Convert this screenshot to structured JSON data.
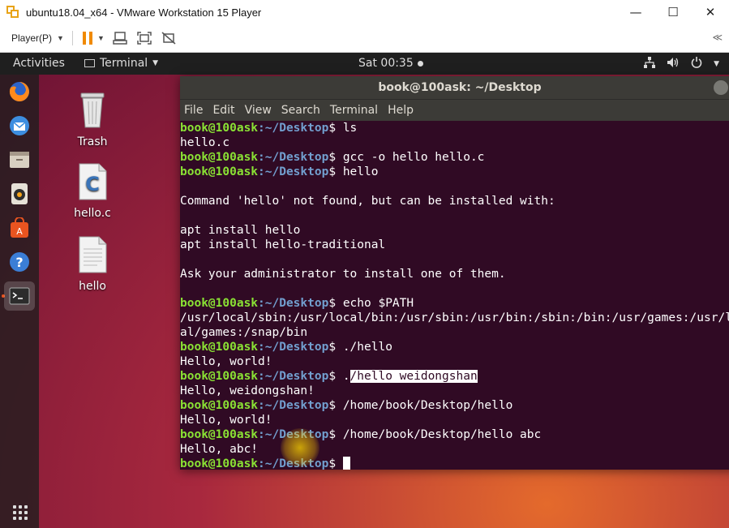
{
  "vm": {
    "title": "ubuntu18.04_x64 - VMware Workstation 15 Player",
    "controls": {
      "minimize": "—",
      "maximize": "☐",
      "close": "✕"
    },
    "player_menu": "Player(P)",
    "collapse": "≪"
  },
  "topbar": {
    "activities": "Activities",
    "app_menu": "Terminal",
    "clock": "Sat 00:35"
  },
  "dock": {
    "items": [
      "firefox",
      "thunderbird",
      "files",
      "rhythmbox",
      "software-center",
      "help",
      "terminal"
    ]
  },
  "desktop": {
    "icons": [
      {
        "label": "Trash"
      },
      {
        "label": "hello.c"
      },
      {
        "label": "hello"
      }
    ]
  },
  "terminal": {
    "title": "book@100ask: ~/Desktop",
    "menu": [
      "File",
      "Edit",
      "View",
      "Search",
      "Terminal",
      "Help"
    ],
    "prompt_user": "book@100ask",
    "prompt_path": ":~/Desktop",
    "prompt_sign": "$ ",
    "lines": [
      {
        "type": "cmd",
        "text": "ls"
      },
      {
        "type": "out",
        "text": "hello.c"
      },
      {
        "type": "cmd",
        "text": "gcc -o hello hello.c"
      },
      {
        "type": "cmd",
        "text": "hello"
      },
      {
        "type": "out",
        "text": ""
      },
      {
        "type": "out",
        "text": "Command 'hello' not found, but can be installed with:"
      },
      {
        "type": "out",
        "text": ""
      },
      {
        "type": "out",
        "text": "apt install hello"
      },
      {
        "type": "out",
        "text": "apt install hello-traditional"
      },
      {
        "type": "out",
        "text": ""
      },
      {
        "type": "out",
        "text": "Ask your administrator to install one of them."
      },
      {
        "type": "out",
        "text": ""
      },
      {
        "type": "cmd",
        "text": "echo $PATH"
      },
      {
        "type": "out",
        "text": "/usr/local/sbin:/usr/local/bin:/usr/sbin:/usr/bin:/sbin:/bin:/usr/games:/usr/loc"
      },
      {
        "type": "out",
        "text": "al/games:/snap/bin"
      },
      {
        "type": "cmd",
        "text": "./hello"
      },
      {
        "type": "out",
        "text": "Hello, world!"
      },
      {
        "type": "cmd",
        "text": "./hello weidongshan",
        "sel_start": 1
      },
      {
        "type": "out",
        "text": "Hello, weidongshan!"
      },
      {
        "type": "cmd",
        "text": "/home/book/Desktop/hello"
      },
      {
        "type": "out",
        "text": "Hello, world!"
      },
      {
        "type": "cmd",
        "text": "/home/book/Desktop/hello abc"
      },
      {
        "type": "out",
        "text": "Hello, abc!"
      },
      {
        "type": "cmd",
        "text": "",
        "cursor": true
      }
    ]
  }
}
